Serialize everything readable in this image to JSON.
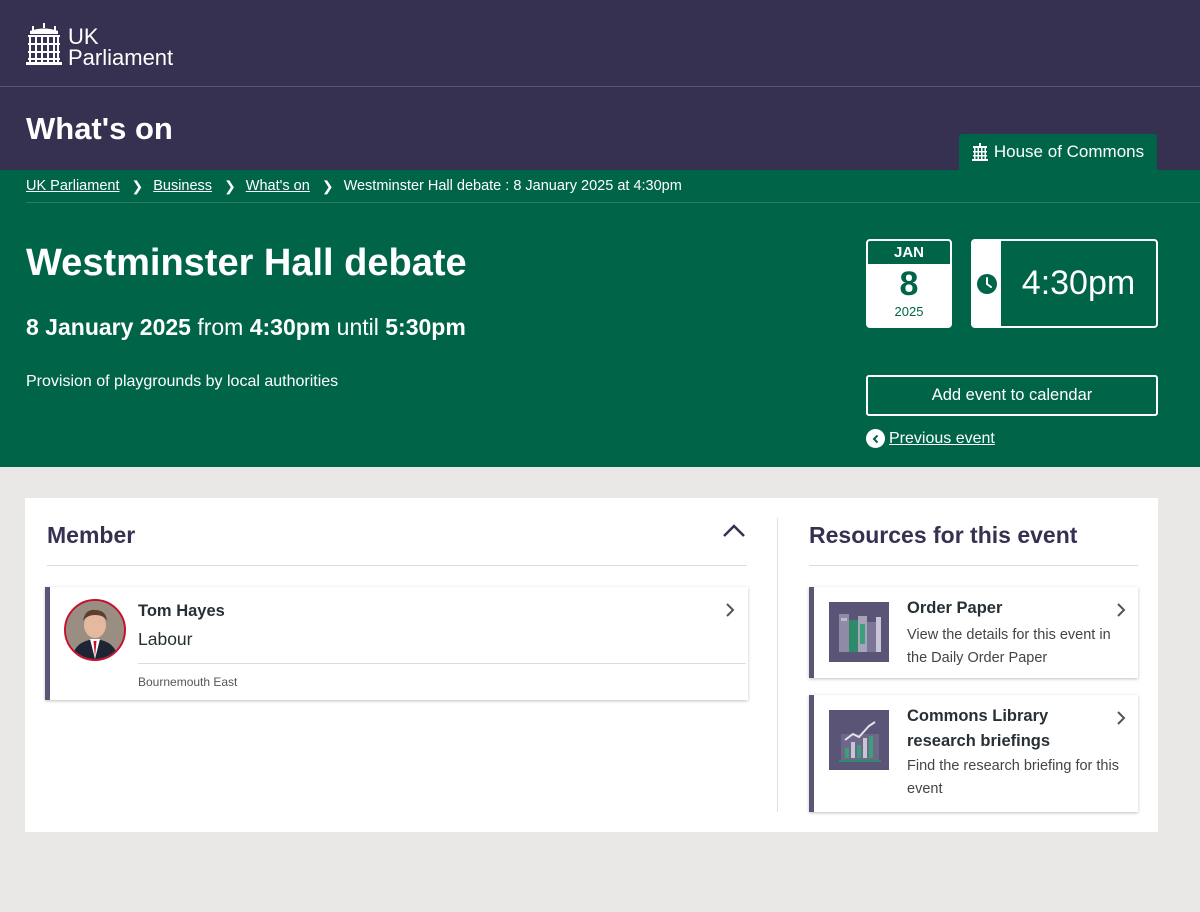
{
  "brand": {
    "logo_line1": "UK",
    "logo_line2": "Parliament"
  },
  "page": {
    "heading": "What's on",
    "house_tab": "House of Commons"
  },
  "breadcrumb": [
    "UK Parliament",
    "Business",
    "What's on",
    "Westminster Hall debate : 8 January 2025 at 4:30pm"
  ],
  "event": {
    "title": "Westminster Hall debate",
    "date": "8 January 2025",
    "from_word": "from",
    "start": "4:30pm",
    "until_word": "until",
    "end": "5:30pm",
    "description": "Provision of playgrounds by local authorities",
    "cal_month": "JAN",
    "cal_day": "8",
    "cal_year": "2025",
    "time": "4:30pm",
    "add_calendar": "Add event to calendar",
    "previous": "Previous event"
  },
  "member_section": {
    "heading": "Member",
    "member": {
      "name": "Tom Hayes",
      "party": "Labour",
      "constituency": "Bournemouth East"
    }
  },
  "resources_section": {
    "heading": "Resources for this event",
    "items": [
      {
        "title": "Order Paper",
        "description": "View the details for this event in the Daily Order Paper",
        "icon": "order-paper-icon"
      },
      {
        "title": "Commons Library research briefings",
        "description": "Find the research briefing for this event",
        "icon": "research-briefing-icon"
      }
    ]
  },
  "colors": {
    "purple": "#373151",
    "green": "#006548",
    "party_red": "#c8102e",
    "background": "#e9e8e6"
  }
}
